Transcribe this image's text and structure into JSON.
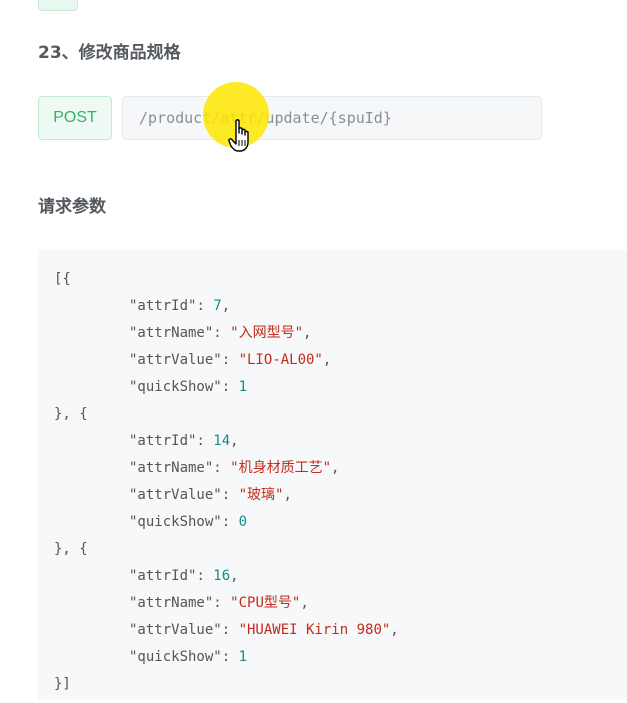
{
  "section": {
    "title": "23、修改商品规格"
  },
  "endpoint": {
    "method": "POST",
    "path": "/product/attr/update/{spuId}"
  },
  "request": {
    "heading": "请求参数"
  },
  "code": {
    "open": "[{",
    "separator": "}, {",
    "close": "}]",
    "items": [
      {
        "attrId": "7",
        "attrName": "\"入网型号\"",
        "attrValue": "\"LIO-AL00\"",
        "quickShow": "1"
      },
      {
        "attrId": "14",
        "attrName": "\"机身材质工艺\"",
        "attrValue": "\"玻璃\"",
        "quickShow": "0"
      },
      {
        "attrId": "16",
        "attrName": "\"CPU型号\"",
        "attrValue": "\"HUAWEI Kirin 980\"",
        "quickShow": "1"
      }
    ],
    "keys": {
      "attrId": "\"attrId\"",
      "attrName": "\"attrName\"",
      "attrValue": "\"attrValue\"",
      "quickShow": "\"quickShow\""
    }
  },
  "colors": {
    "method_green": "#2fb56a",
    "string_red": "#c42b1c",
    "number_teal": "#1a8a8a",
    "cursor_highlight": "#ffe600"
  },
  "icons": {
    "cursor": "hand-pointer-icon"
  }
}
